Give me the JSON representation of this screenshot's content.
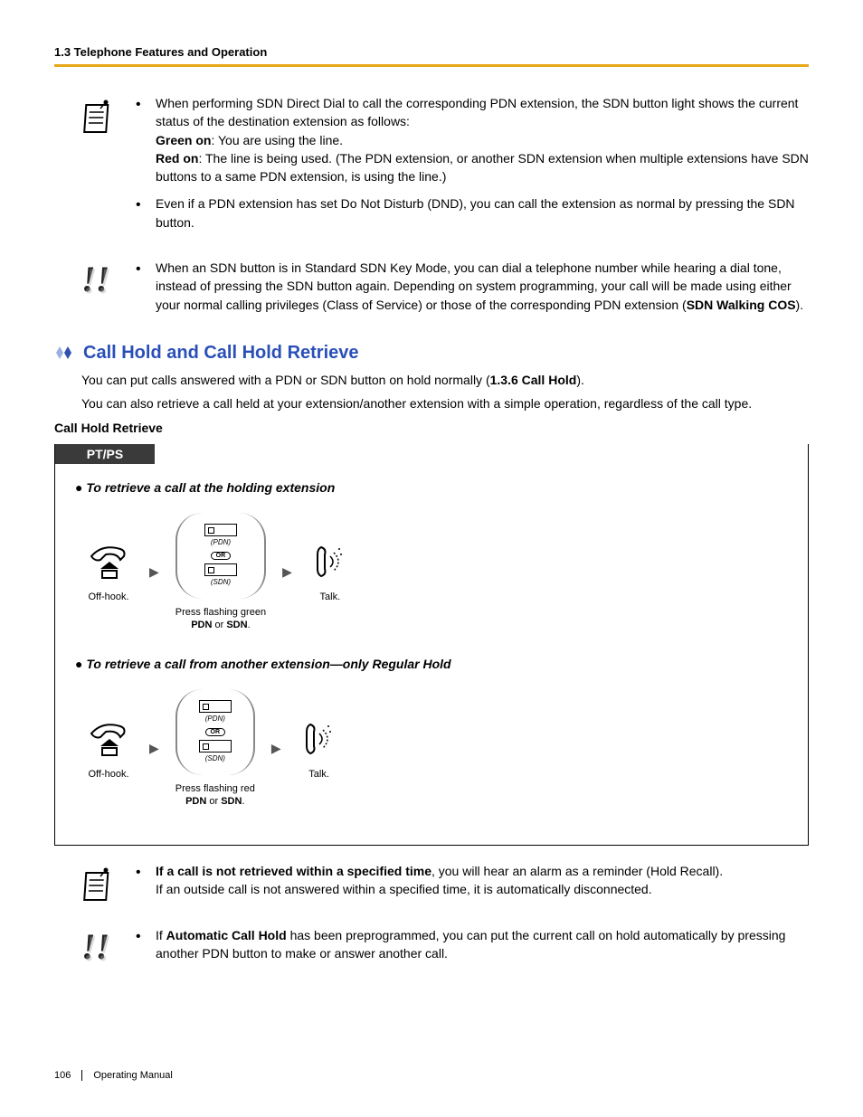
{
  "header": "1.3 Telephone Features and Operation",
  "note1": {
    "b1_intro": "When performing SDN Direct Dial to call the corresponding PDN extension, the SDN button light shows the current status of the destination extension as follows:",
    "b1_green_lbl": "Green on",
    "b1_green_txt": ": You are using the line.",
    "b1_red_lbl": "Red on",
    "b1_red_txt": ": The line is being used. (The PDN extension, or another SDN extension when multiple extensions have SDN buttons to a same PDN extension, is using the line.)",
    "b2": "Even if a PDN extension has set Do Not Disturb (DND), you can call the extension as normal by pressing the SDN button."
  },
  "note2": {
    "b1_a": "When an SDN button is in Standard SDN Key Mode, you can dial a telephone number while hearing a dial tone, instead of pressing the SDN button again. Depending on system programming, your call will be made using either your normal calling privileges (Class of Service) or those of the corresponding PDN extension (",
    "b1_bold": "SDN Walking COS",
    "b1_b": ")."
  },
  "section": {
    "title": "Call Hold and Call Hold Retrieve",
    "p1_a": "You can put calls answered with a PDN or SDN button on hold normally (",
    "p1_bold": "1.3.6 Call Hold",
    "p1_b": ").",
    "p2": "You can also retrieve a call held at your extension/another extension with a simple operation, regardless of the call type.",
    "subhead": "Call Hold Retrieve"
  },
  "proc": {
    "tab": "PT/PS",
    "t1": "To retrieve a call at the holding extension",
    "t2": "To retrieve a call from another extension—only Regular Hold",
    "offhook": "Off-hook.",
    "press_green_a": "Press flashing green",
    "press_red_a": "Press flashing red",
    "pdn": "PDN",
    "or": " or ",
    "sdn": "SDN",
    "period": ".",
    "talk": "Talk.",
    "pdn_lbl": "(PDN)",
    "sdn_lbl": "(SDN)",
    "or_pill": "OR"
  },
  "note3": {
    "b1_bold": "If a call is not retrieved within a specified time",
    "b1_a": ", you will hear an alarm as a reminder (Hold Recall).",
    "b1_b": "If an outside call is not answered within a specified time, it is automatically disconnected."
  },
  "note4": {
    "b1_a": "If ",
    "b1_bold": "Automatic Call Hold",
    "b1_b": " has been preprogrammed, you can put the current call on hold automatically by pressing another PDN button to make or answer another call."
  },
  "footer": {
    "page": "106",
    "title": "Operating Manual"
  }
}
